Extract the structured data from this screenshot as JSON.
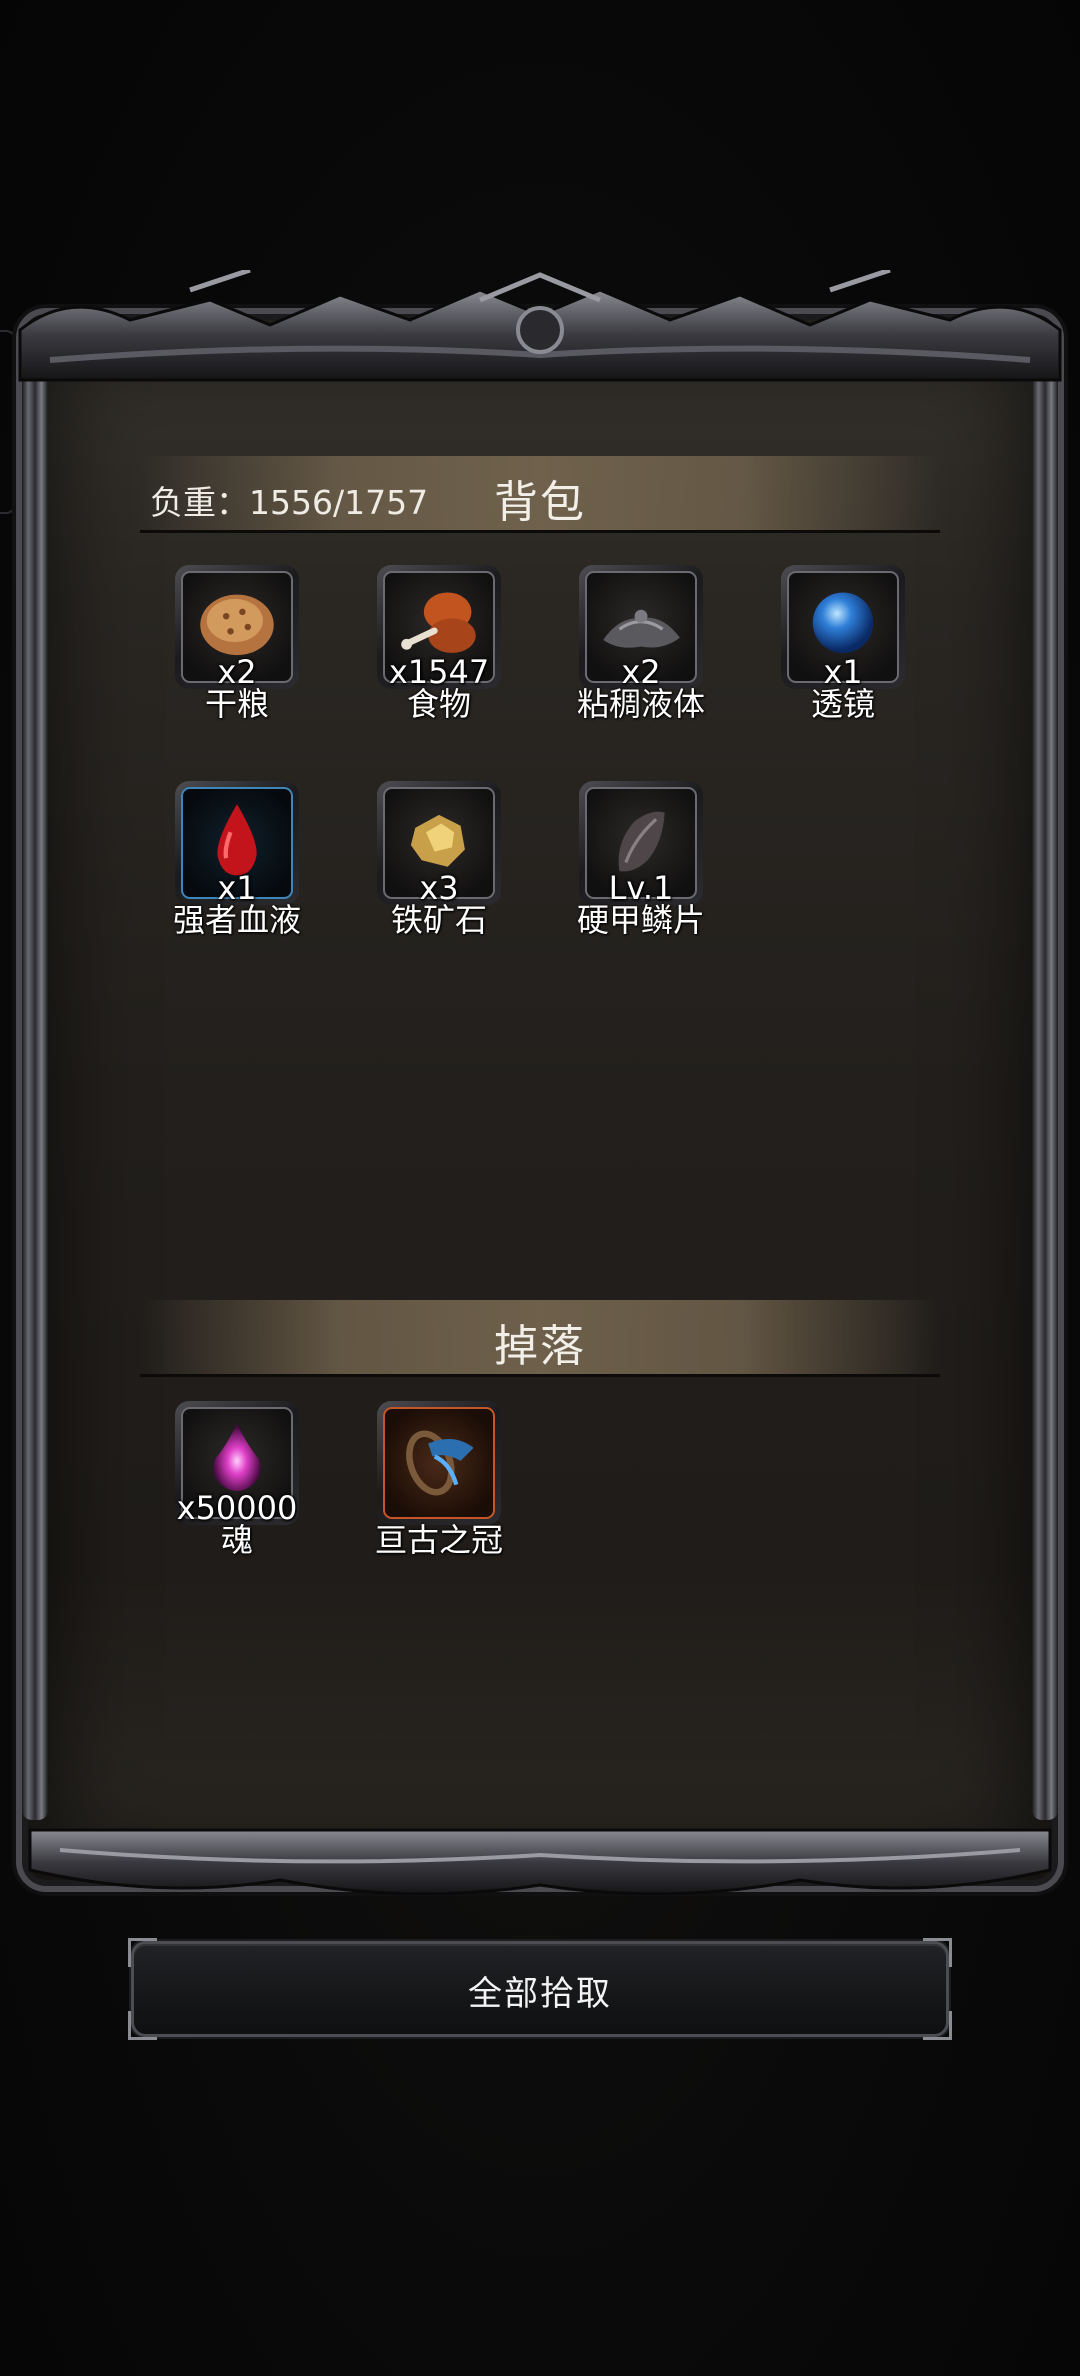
{
  "backpack": {
    "title": "背包",
    "weight_text": "负重：1556/1757",
    "items": [
      {
        "name": "干粮",
        "qty": "x2",
        "icon": "bread-icon"
      },
      {
        "name": "食物",
        "qty": "x1547",
        "icon": "meat-icon"
      },
      {
        "name": "粘稠液体",
        "qty": "x2",
        "icon": "slime-icon"
      },
      {
        "name": "透镜",
        "qty": "x1",
        "icon": "lens-orb-icon"
      },
      {
        "name": "强者血液",
        "qty": "x1",
        "icon": "blood-drop-icon"
      },
      {
        "name": "铁矿石",
        "qty": "x3",
        "icon": "iron-ore-icon"
      },
      {
        "name": "硬甲鳞片",
        "qty": "Lv.1",
        "icon": "scale-icon"
      }
    ]
  },
  "drops": {
    "title": "掉落",
    "items": [
      {
        "name": "魂",
        "qty": "x50000",
        "icon": "soul-icon"
      },
      {
        "name": "亘古之冠",
        "qty": "",
        "icon": "crown-icon"
      }
    ]
  },
  "actions": {
    "pickup_all": "全部拾取"
  },
  "colors": {
    "panel_bg": "#221f1c",
    "rare_blue": "#3e85b8",
    "epic_orange": "#c6552a"
  }
}
